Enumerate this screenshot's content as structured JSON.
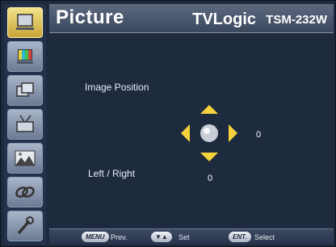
{
  "header": {
    "title": "Picture",
    "brand": "TVLogic",
    "model": "TSM-232W"
  },
  "sidebar": {
    "items": [
      {
        "icon": "monitor-icon",
        "active": true
      },
      {
        "icon": "color-bars-icon",
        "active": false
      },
      {
        "icon": "windows-icon",
        "active": false
      },
      {
        "icon": "tv-antenna-icon",
        "active": false
      },
      {
        "icon": "landscape-image-icon",
        "active": false
      },
      {
        "icon": "link-icon",
        "active": false
      },
      {
        "icon": "tools-icon",
        "active": false
      }
    ]
  },
  "main": {
    "image_position_label": "Image Position",
    "left_right_label": "Left / Right",
    "left_right_value": "0",
    "up_down_value": "0"
  },
  "footer": {
    "menu_key": "MENU",
    "menu_label": "Prev.",
    "set_key": "▼▲",
    "set_label": "Set",
    "ent_key": "ENT.",
    "ent_label": "Select"
  },
  "colors": {
    "accent": "#f4d23c",
    "background": "#1e2a3e",
    "header": "#4a566c"
  }
}
